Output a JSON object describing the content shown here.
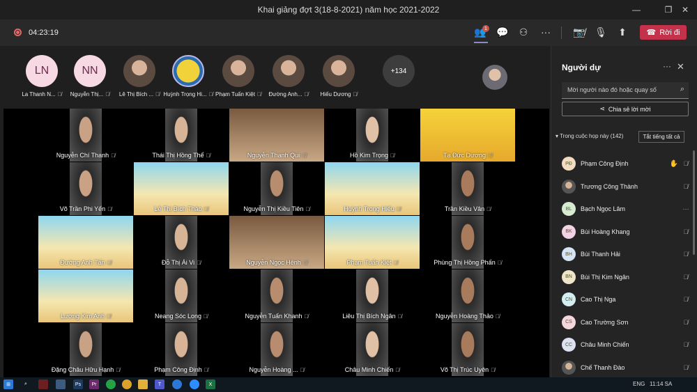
{
  "window": {
    "title": "Khai giảng đợt 3(18-8-2021) năm học 2021-2022"
  },
  "toolbar": {
    "timer": "04:23:19",
    "participant_badge": "1",
    "leave_label": "Rời đi"
  },
  "strip": {
    "people": [
      {
        "initials": "LN",
        "name": "La Thanh N..."
      },
      {
        "initials": "NN",
        "name": "Nguyễn Thị..."
      },
      {
        "initials": "",
        "name": "Lê Thị Bích ..."
      },
      {
        "initials": "",
        "name": "Huỳnh Trọng Hi..."
      },
      {
        "initials": "",
        "name": "Phạm Tuấn Kiệt"
      },
      {
        "initials": "",
        "name": "Đường Anh..."
      },
      {
        "initials": "",
        "name": "Hiếu Dương"
      }
    ],
    "more_count": "+134"
  },
  "grid": {
    "tiles": [
      {
        "name": "Nguyễn Chí Thanh",
        "style": "person"
      },
      {
        "name": "Thái Thị Hồng Thể",
        "style": "person"
      },
      {
        "name": "Nguyễn Thanh Qui",
        "style": "wide"
      },
      {
        "name": "Hồ Kim Trọng",
        "style": "person"
      },
      {
        "name": "Tạ Đức Dương",
        "style": "yellow"
      },
      {
        "name": "Võ Trần Phi Yến",
        "style": "person"
      },
      {
        "name": "Lê Thị Bích Thảo",
        "style": "banner"
      },
      {
        "name": "Nguyễn Thị Kiều Tiên",
        "style": "person"
      },
      {
        "name": "Huỳnh Trọng Hiếu",
        "style": "banner"
      },
      {
        "name": "Trần Kiều Vân",
        "style": "person"
      },
      {
        "name": "Đường Anh Tấn",
        "style": "banner"
      },
      {
        "name": "Đỗ Thị Ái Vi",
        "style": "person"
      },
      {
        "name": "Nguyễn Ngọc Hênh",
        "style": "wide"
      },
      {
        "name": "Phạm Tuấn Kiệt",
        "style": "banner"
      },
      {
        "name": "Phùng Thị Hồng Phấn",
        "style": "person"
      },
      {
        "name": "Lương Kim Anh",
        "style": "banner"
      },
      {
        "name": "Neang Sóc Long",
        "style": "person"
      },
      {
        "name": "Nguyễn Tuấn Khanh",
        "style": "person"
      },
      {
        "name": "Liêu Thị Bích Ngân",
        "style": "person"
      },
      {
        "name": "Nguyễn Hoàng Thảo",
        "style": "person"
      },
      {
        "name": "Đặng Châu Hữu Hạnh",
        "style": "person"
      },
      {
        "name": "Phạm Công Định",
        "style": "person"
      },
      {
        "name": "Nguyễn Hoàng ...",
        "style": "person"
      },
      {
        "name": "Châu Minh Chiến",
        "style": "person"
      },
      {
        "name": "Võ Thị Trúc Uyên",
        "style": "person"
      }
    ]
  },
  "panel": {
    "title": "Người dự",
    "invite_placeholder": "Mời người nào đó hoặc quay số",
    "share_label": "Chia sẻ lời mời",
    "section_label": "Trong cuộc họp này (142)",
    "mute_all": "Tắt tiếng tất cả",
    "participants": [
      {
        "initials": "PĐ",
        "name": "Phạm Công Định",
        "color": "#f3dcc0",
        "hand": true
      },
      {
        "initials": "",
        "name": "Trương Công Thành",
        "color": "#cfd3dd"
      },
      {
        "initials": "BL",
        "name": "Bạch Ngọc Lâm",
        "color": "#d7ebd3",
        "more": true
      },
      {
        "initials": "BK",
        "name": "Bùi Hoàng Khang",
        "color": "#f3d3e3"
      },
      {
        "initials": "BH",
        "name": "Bùi Thanh Hải",
        "color": "#d6e4f6"
      },
      {
        "initials": "BN",
        "name": "Bùi Thị Kim Ngân",
        "color": "#efe6c9"
      },
      {
        "initials": "CN",
        "name": "Cao Thị Nga",
        "color": "#d3eef0"
      },
      {
        "initials": "CS",
        "name": "Cao Trường Sơn",
        "color": "#f5d6dc"
      },
      {
        "initials": "CC",
        "name": "Châu Minh Chiến",
        "color": "#dde2f3"
      },
      {
        "initials": "",
        "name": "Chế Thanh Đào",
        "color": "#cfd3dd"
      }
    ]
  },
  "taskbar": {
    "lang": "ENG",
    "time": "11:14 SA"
  }
}
